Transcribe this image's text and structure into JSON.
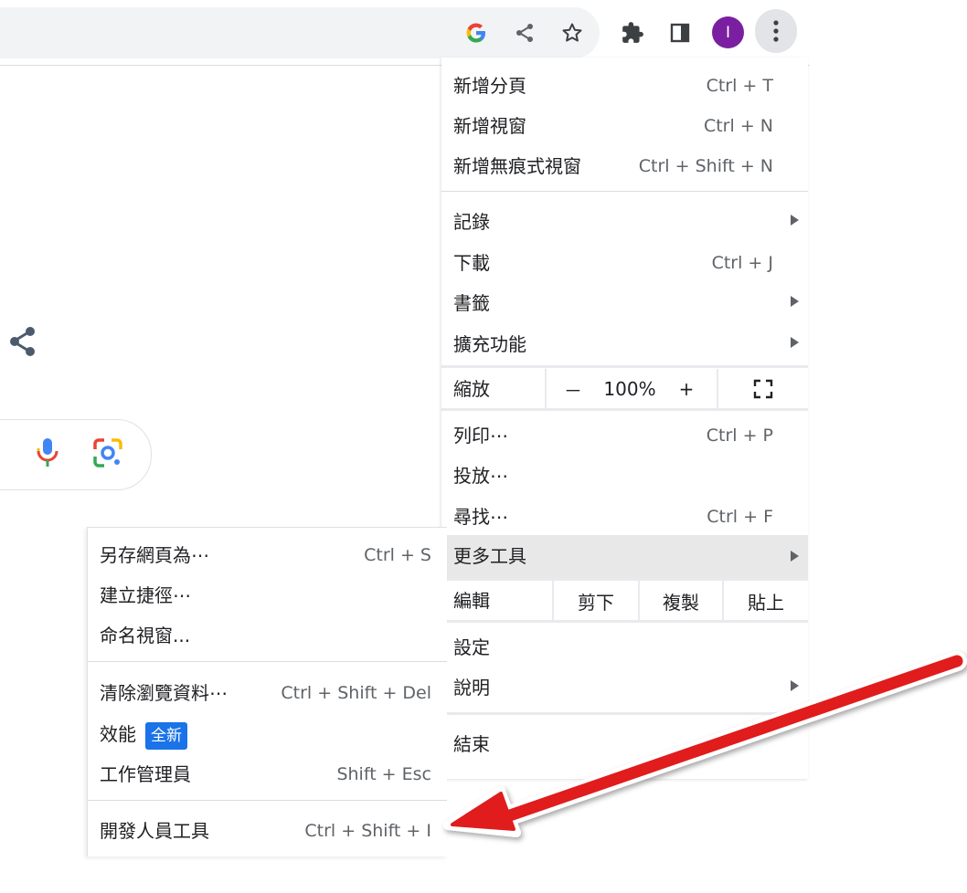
{
  "colors": {
    "accent": "#1a73e8",
    "arrow": "#e01b1b",
    "avatar": "#7b1fa2",
    "highlight": "#e8e8e8"
  },
  "toolbar": {
    "icons": [
      "google-icon",
      "share-icon",
      "star-icon",
      "puzzle-icon",
      "side-panel-icon",
      "avatar",
      "kebab-icon"
    ],
    "google_letter": "G",
    "avatar_letter": "I"
  },
  "main_menu": {
    "new_tab": {
      "label": "新增分頁",
      "shortcut": "Ctrl + T"
    },
    "new_window": {
      "label": "新增視窗",
      "shortcut": "Ctrl + N"
    },
    "incognito": {
      "label": "新增無痕式視窗",
      "shortcut": "Ctrl + Shift + N"
    },
    "history": {
      "label": "記錄"
    },
    "downloads": {
      "label": "下載",
      "shortcut": "Ctrl + J"
    },
    "bookmarks": {
      "label": "書籤"
    },
    "extensions": {
      "label": "擴充功能"
    },
    "zoom": {
      "label": "縮放",
      "minus": "－",
      "value": "100%",
      "plus": "+"
    },
    "print": {
      "label": "列印⋯",
      "shortcut": "Ctrl + P"
    },
    "cast": {
      "label": "投放⋯"
    },
    "find": {
      "label": "尋找⋯",
      "shortcut": "Ctrl + F"
    },
    "more_tools": {
      "label": "更多工具"
    },
    "edit": {
      "label": "編輯",
      "cut": "剪下",
      "copy": "複製",
      "paste": "貼上"
    },
    "settings": {
      "label": "設定"
    },
    "help": {
      "label": "說明"
    },
    "exit": {
      "label": "結束"
    }
  },
  "sub_menu": {
    "save_page": {
      "label": "另存網頁為⋯",
      "shortcut": "Ctrl + S"
    },
    "create_shortcut": {
      "label": "建立捷徑⋯"
    },
    "name_window": {
      "label": "命名視窗..."
    },
    "clear_data": {
      "label": "清除瀏覽資料⋯",
      "shortcut": "Ctrl + Shift + Del"
    },
    "performance": {
      "label": "效能",
      "badge": "全新"
    },
    "task_manager": {
      "label": "工作管理員",
      "shortcut": "Shift + Esc"
    },
    "dev_tools": {
      "label": "開發人員工具",
      "shortcut": "Ctrl + Shift + I"
    }
  }
}
